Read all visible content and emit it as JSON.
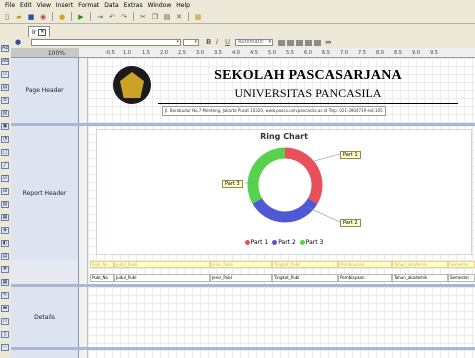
{
  "menu": [
    "File",
    "Edit",
    "View",
    "Insert",
    "Format",
    "Data",
    "Extras",
    "Window",
    "Help"
  ],
  "toolbar_icons": [
    "new-icon",
    "open-icon",
    "save-icon",
    "data-icon",
    "run-icon",
    "step-icon",
    "undo-icon",
    "redo-icon",
    "cut-icon",
    "copy-icon",
    "paste-icon",
    "delete-icon",
    "format-paint-icon"
  ],
  "doc_tab": {
    "label": "Ir"
  },
  "format_bar": {
    "font": "Automatic"
  },
  "zoom": "100%",
  "ruler": [
    "-0.5",
    "1.0",
    "1.5",
    "2.0",
    "2.5",
    "3.0",
    "3.5",
    "4.0",
    "4.5",
    "5.0",
    "5.5",
    "6.0",
    "6.5",
    "7.0",
    "7.5",
    "8.0",
    "8.5",
    "9.0",
    "9.5"
  ],
  "sections": {
    "page_header": "Page Header",
    "report_header": "Report Header",
    "details": "Details"
  },
  "page_header": {
    "title1": "SEKOLAH PASCASARJANA",
    "title2": "UNIVERSITAS PANCASILA",
    "address": "Jl. Borobudur No.7 Menteng, Jakarta Pusat 10320,   www.pasca.univpancasila.ac.id   Telp: 021-3904739 ext.105"
  },
  "chart_data": {
    "type": "pie",
    "title": "Ring Chart",
    "categories": [
      "Part 1",
      "Part 2",
      "Part 3"
    ],
    "values": [
      1,
      1,
      1
    ],
    "colors": [
      "#e9505a",
      "#4f59d6",
      "#58d14f"
    ],
    "legend_position": "bottom"
  },
  "table_headers": [
    "Publ_No  ",
    "Judul_Publi",
    "Jenis_Publi",
    "Tingkat_Publi",
    "Pembiayaan",
    "Tahun_akademik",
    "Semester"
  ],
  "table_fields": [
    "Publ_No",
    "Judul_Publ",
    "Jenis_Publ",
    "Tingkat_Publ",
    "Pembiayaan",
    "Tahun_akademik",
    "Semester"
  ]
}
